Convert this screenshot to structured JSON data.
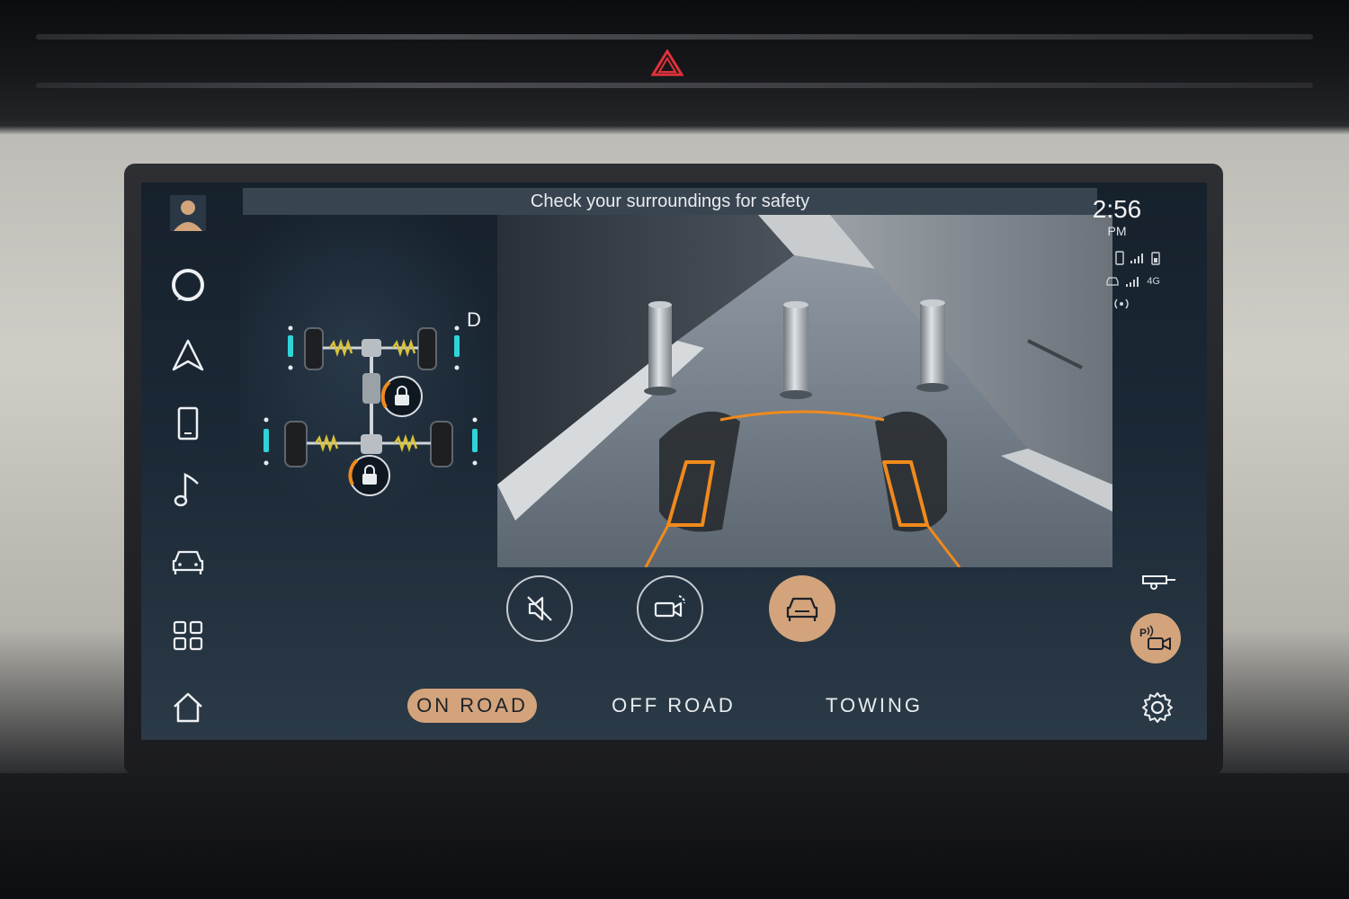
{
  "banner": {
    "text": "Check your surroundings for safety"
  },
  "clock": {
    "time": "2:56",
    "period": "PM"
  },
  "status": {
    "network_label": "4G"
  },
  "drivetrain": {
    "gear": "D"
  },
  "modes": {
    "on_road": "ON ROAD",
    "off_road": "OFF ROAD",
    "towing": "TOWING",
    "active": "on_road"
  },
  "nav": {
    "items": [
      "profile-icon",
      "alexa-icon",
      "navigation-icon",
      "phone-icon",
      "music-icon",
      "vehicle-icon",
      "apps-grid-icon",
      "home-icon"
    ]
  },
  "actions": [
    "mute-icon",
    "camera-view-icon",
    "car-view-icon"
  ],
  "colors": {
    "accent": "#d3a47c",
    "guide_line": "#f08a1c",
    "background": "#1b2835",
    "strut": "#2fd4d8"
  }
}
